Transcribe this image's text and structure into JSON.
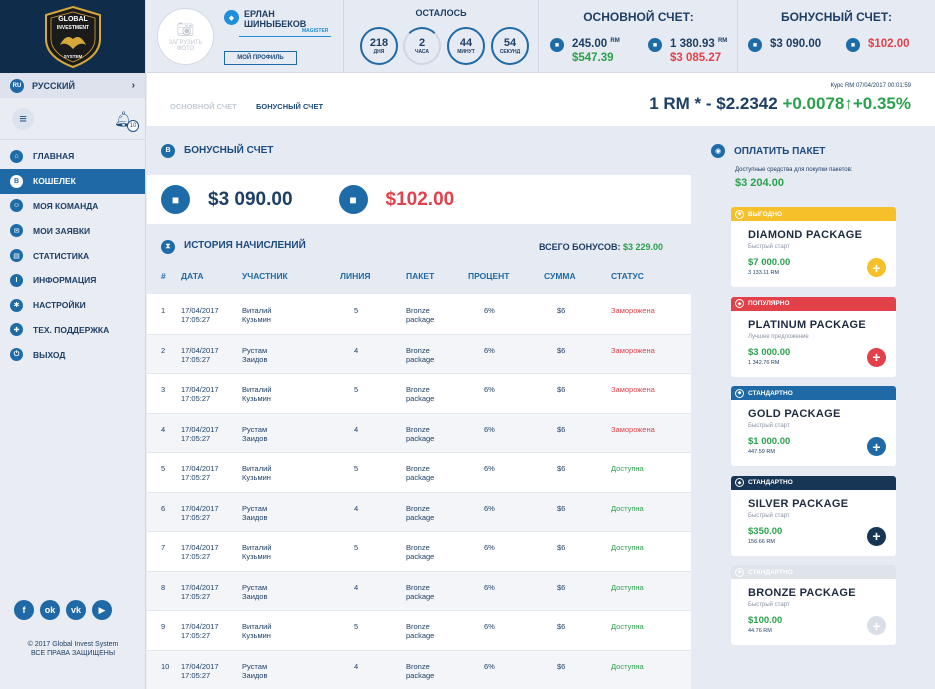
{
  "sidebar": {
    "logo": {
      "line1": "GLOBAL",
      "line2": "INVESTMENT",
      "line3": "SYSTEM"
    },
    "language": {
      "code": "RU",
      "label": "Русский"
    },
    "notifications_count": "10",
    "nav": [
      {
        "label": "Главная",
        "icon": "home-icon",
        "glyph": "⌂"
      },
      {
        "label": "Кошелек",
        "icon": "bitcoin-icon",
        "glyph": "B"
      },
      {
        "label": "Моя команда",
        "icon": "team-icon",
        "glyph": "☺"
      },
      {
        "label": "Мои заявки",
        "icon": "requests-icon",
        "glyph": "✉"
      },
      {
        "label": "Статистика",
        "icon": "stats-icon",
        "glyph": "▤"
      },
      {
        "label": "Информация",
        "icon": "info-icon",
        "glyph": "i"
      },
      {
        "label": "Настройки",
        "icon": "settings-icon",
        "glyph": "✱"
      },
      {
        "label": "Тех. поддержка",
        "icon": "support-icon",
        "glyph": "✚"
      },
      {
        "label": "Выход",
        "icon": "logout-icon",
        "glyph": "⏻"
      }
    ],
    "active_index": 1,
    "socials": [
      {
        "name": "facebook-icon",
        "glyph": "f"
      },
      {
        "name": "odnoklassniki-icon",
        "glyph": "ok"
      },
      {
        "name": "vk-icon",
        "glyph": "vk"
      },
      {
        "name": "youtube-icon",
        "glyph": "▶"
      }
    ],
    "copyright_line1": "© 2017 Global Invest System",
    "copyright_line2": "ВСЕ ПРАВА ЗАЩИЩЕНЫ"
  },
  "header": {
    "avatar_label_1": "ЗАГРУЗИТЬ",
    "avatar_label_2": "ФОТО",
    "user_first": "ЕРЛАН",
    "user_last": "ШИНЫБЕКОВ",
    "rank": "MAGISTER",
    "profile_button": "МОЙ ПРОФИЛЬ",
    "timer_title": "ОСТАЛОСЬ",
    "timer": [
      {
        "value": "218",
        "unit": "дня"
      },
      {
        "value": "2",
        "unit": "часа"
      },
      {
        "value": "44",
        "unit": "минут"
      },
      {
        "value": "54",
        "unit": "секунд"
      }
    ],
    "main_account": {
      "title": "ОСНОВНОЙ СЧЕТ:",
      "rm1": "245.00",
      "usd1": "$547.39",
      "rm2": "1 380.93",
      "usd2": "$3 085.27",
      "rm_unit": "RM"
    },
    "bonus_account": {
      "title": "БОНУСНЫЙ СЧЕТ:",
      "amount1": "$3 090.00",
      "amount2": "$102.00"
    }
  },
  "subbar": {
    "tab_main": "ОСНОВНОЙ СЧЕТ",
    "tab_bonus": "БОНУСНЫЙ СЧЕТ",
    "rate_label": "Курс RM 07/04/2017 00:01:59",
    "rate_text": "1 RM * - $2.2342",
    "rate_change": "+0.0078↑+0.35%"
  },
  "bonus": {
    "title": "БОНУСНЫЙ СЧЕТ",
    "amount_available": "$3 090.00",
    "amount_frozen": "$102.00",
    "history_title": "ИСТОРИЯ НАЧИСЛЕНИЙ",
    "total_label": "ВСЕГО БОНУСОВ:",
    "total_value": "$3 229.00",
    "columns": [
      "#",
      "ДАТА",
      "УЧАСТНИК",
      "ЛИНИЯ",
      "ПАКЕТ",
      "ПРОЦЕНТ",
      "СУММА",
      "СТАТУС"
    ],
    "rows": [
      {
        "n": "1",
        "date1": "17/04/2017",
        "date2": "17:05:27",
        "p1": "Виталий",
        "p2": "Кузьмин",
        "line": "5",
        "pk1": "Bronze",
        "pk2": "package",
        "pct": "6%",
        "sum": "$6",
        "status": "Заморожена",
        "frozen": true
      },
      {
        "n": "2",
        "date1": "17/04/2017",
        "date2": "17:05:27",
        "p1": "Рустам",
        "p2": "Заидов",
        "line": "4",
        "pk1": "Bronze",
        "pk2": "package",
        "pct": "6%",
        "sum": "$6",
        "status": "Заморожена",
        "frozen": true
      },
      {
        "n": "3",
        "date1": "17/04/2017",
        "date2": "17:05:27",
        "p1": "Виталий",
        "p2": "Кузьмин",
        "line": "5",
        "pk1": "Bronze",
        "pk2": "package",
        "pct": "6%",
        "sum": "$6",
        "status": "Заморожена",
        "frozen": true
      },
      {
        "n": "4",
        "date1": "17/04/2017",
        "date2": "17:05:27",
        "p1": "Рустам",
        "p2": "Заидов",
        "line": "4",
        "pk1": "Bronze",
        "pk2": "package",
        "pct": "6%",
        "sum": "$6",
        "status": "Заморожена",
        "frozen": true
      },
      {
        "n": "5",
        "date1": "17/04/2017",
        "date2": "17:05:27",
        "p1": "Виталий",
        "p2": "Кузьмин",
        "line": "5",
        "pk1": "Bronze",
        "pk2": "package",
        "pct": "6%",
        "sum": "$6",
        "status": "Доступна",
        "frozen": false
      },
      {
        "n": "6",
        "date1": "17/04/2017",
        "date2": "17:05:27",
        "p1": "Рустам",
        "p2": "Заидов",
        "line": "4",
        "pk1": "Bronze",
        "pk2": "package",
        "pct": "6%",
        "sum": "$6",
        "status": "Доступна",
        "frozen": false
      },
      {
        "n": "7",
        "date1": "17/04/2017",
        "date2": "17:05:27",
        "p1": "Виталий",
        "p2": "Кузьмин",
        "line": "5",
        "pk1": "Bronze",
        "pk2": "package",
        "pct": "6%",
        "sum": "$6",
        "status": "Доступна",
        "frozen": false
      },
      {
        "n": "8",
        "date1": "17/04/2017",
        "date2": "17:05:27",
        "p1": "Рустам",
        "p2": "Заидов",
        "line": "4",
        "pk1": "Bronze",
        "pk2": "package",
        "pct": "6%",
        "sum": "$6",
        "status": "Доступна",
        "frozen": false
      },
      {
        "n": "9",
        "date1": "17/04/2017",
        "date2": "17:05:27",
        "p1": "Виталий",
        "p2": "Кузьмин",
        "line": "5",
        "pk1": "Bronze",
        "pk2": "package",
        "pct": "6%",
        "sum": "$6",
        "status": "Доступна",
        "frozen": false
      },
      {
        "n": "10",
        "date1": "17/04/2017",
        "date2": "17:05:27",
        "p1": "Рустам",
        "p2": "Заидов",
        "line": "4",
        "pk1": "Bronze",
        "pk2": "package",
        "pct": "6%",
        "sum": "$6",
        "status": "Доступна",
        "frozen": false
      }
    ]
  },
  "pay": {
    "title": "ОПЛАТИТЬ ПАКЕТ",
    "available_label": "Доступные средства для покупки пакетов:",
    "available_value": "$3 204.00",
    "packages": [
      {
        "tag": "Выгодно",
        "tag_color": "#f5c02a",
        "name": "DIAMOND PACKAGE",
        "sub": "Быстрый старт",
        "price": "$7 000.00",
        "rm": "3 133.11 RM",
        "btn_color": "#f5c02a",
        "dim": false
      },
      {
        "tag": "Популярно",
        "tag_color": "#e2414a",
        "name": "PLATINUM PACKAGE",
        "sub": "Лучшее предложение",
        "price": "$3 000.00",
        "rm": "1 342.76 RM",
        "btn_color": "#e2414a",
        "dim": false
      },
      {
        "tag": "Стандартно",
        "tag_color": "#1f6aa6",
        "name": "GOLD PACKAGE",
        "sub": "Быстрый старт",
        "price": "$1 000.00",
        "rm": "447.59 RM",
        "btn_color": "#1f6aa6",
        "dim": false
      },
      {
        "tag": "Стандартно",
        "tag_color": "#173555",
        "name": "SILVER PACKAGE",
        "sub": "Быстрый старт",
        "price": "$350.00",
        "rm": "156.66 RM",
        "btn_color": "#173555",
        "dim": false
      },
      {
        "tag": "Стандартно",
        "tag_color": "#d0d6e0",
        "name": "BRONZE PACKAGE",
        "sub": "Быстрый старт",
        "price": "$100.00",
        "rm": "44.76 RM",
        "btn_color": "#d9dee7",
        "dim": true
      }
    ]
  }
}
